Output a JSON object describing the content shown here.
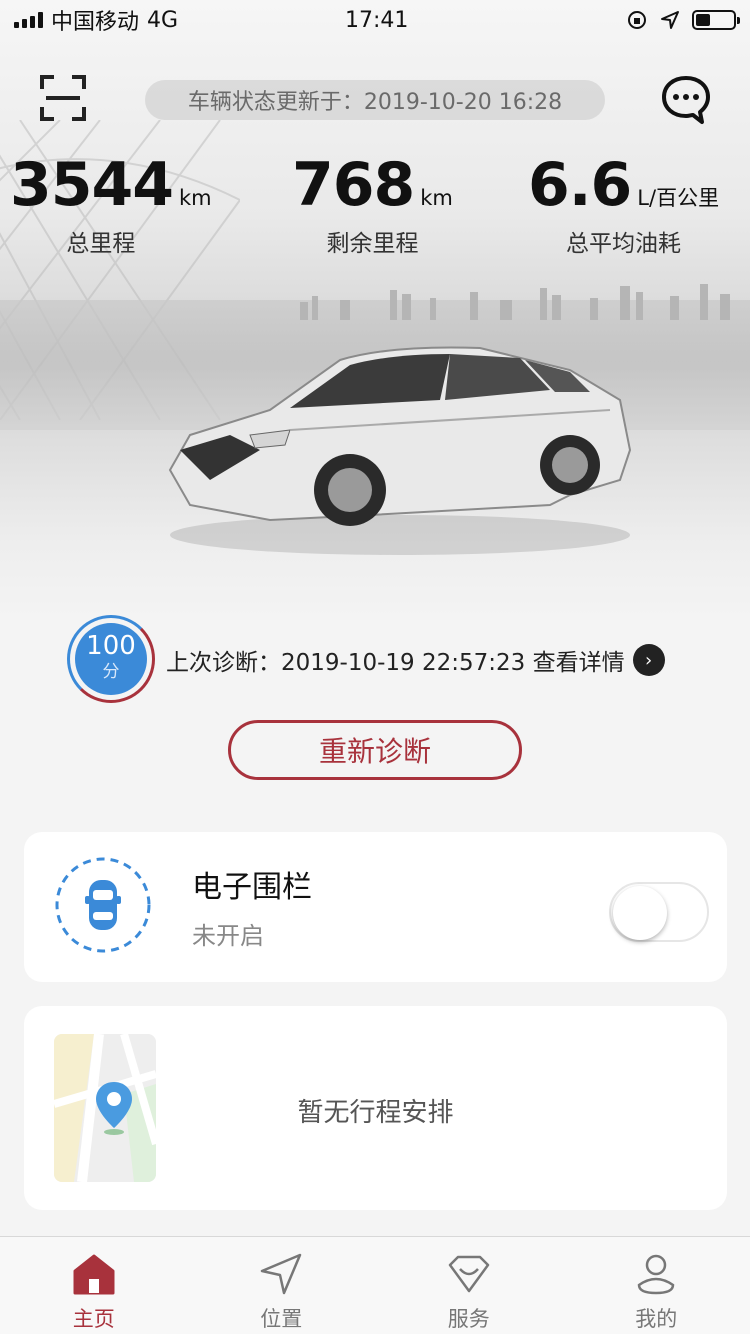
{
  "status_bar": {
    "carrier": "中国移动",
    "network": "4G",
    "time": "17:41"
  },
  "header": {
    "update_text": "车辆状态更新于：2019-10-20 16:28"
  },
  "stats": [
    {
      "value": "3544",
      "unit": "km",
      "label": "总里程"
    },
    {
      "value": "768",
      "unit": "km",
      "label": "剩余里程"
    },
    {
      "value": "6.6",
      "unit": "L/百公里",
      "label": "总平均油耗"
    }
  ],
  "diagnosis": {
    "score": "100",
    "score_unit": "分",
    "text": "上次诊断：2019-10-19 22:57:23 查看详情",
    "rediagnose_label": "重新诊断"
  },
  "fence": {
    "title": "电子围栏",
    "status": "未开启",
    "enabled": false
  },
  "trip": {
    "empty_text": "暂无行程安排"
  },
  "tabs": [
    {
      "label": "主页",
      "icon": "home-icon",
      "active": true
    },
    {
      "label": "位置",
      "icon": "navigation-arrow-icon",
      "active": false
    },
    {
      "label": "服务",
      "icon": "service-heart-icon",
      "active": false
    },
    {
      "label": "我的",
      "icon": "user-icon",
      "active": false
    }
  ],
  "colors": {
    "accent": "#a8323c",
    "blue": "#3b8ad8",
    "background": "#f4f4f4"
  }
}
